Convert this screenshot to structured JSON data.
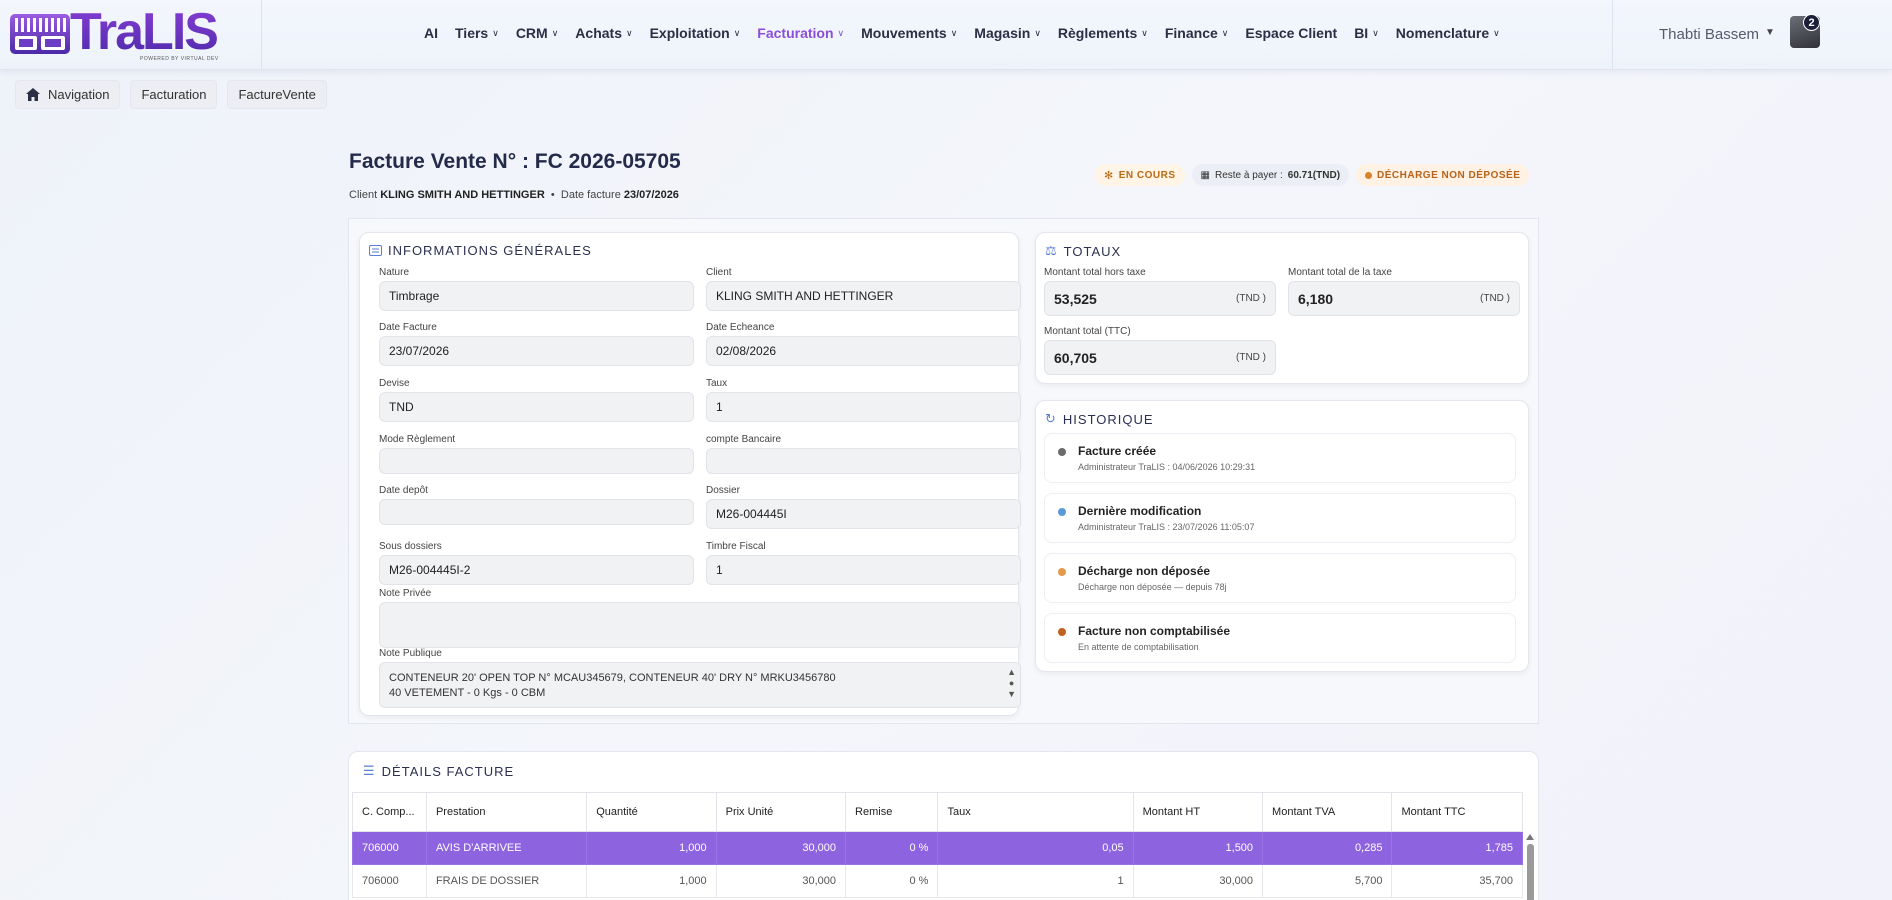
{
  "brand": {
    "logo_text": "TraLIS",
    "logo_tagline": "POWERED BY VIRTUAL DEV"
  },
  "nav": [
    {
      "label": "AI",
      "has_menu": false,
      "active": false
    },
    {
      "label": "Tiers",
      "has_menu": true,
      "active": false
    },
    {
      "label": "CRM",
      "has_menu": true,
      "active": false
    },
    {
      "label": "Achats",
      "has_menu": true,
      "active": false
    },
    {
      "label": "Exploitation",
      "has_menu": true,
      "active": false
    },
    {
      "label": "Facturation",
      "has_menu": true,
      "active": true
    },
    {
      "label": "Mouvements",
      "has_menu": true,
      "active": false
    },
    {
      "label": "Magasin",
      "has_menu": true,
      "active": false
    },
    {
      "label": "Règlements",
      "has_menu": true,
      "active": false
    },
    {
      "label": "Finance",
      "has_menu": true,
      "active": false
    },
    {
      "label": "Espace Client",
      "has_menu": false,
      "active": false
    },
    {
      "label": "BI",
      "has_menu": true,
      "active": false
    },
    {
      "label": "Nomenclature",
      "has_menu": true,
      "active": false
    }
  ],
  "user": {
    "name": "Thabti Bassem",
    "notifications": "2"
  },
  "breadcrumb": {
    "home_icon": "home-icon",
    "items": [
      "Navigation",
      "Facturation",
      "FactureVente"
    ]
  },
  "page": {
    "title": "Facture Vente N° : FC 2026-05705",
    "client_label": "Client",
    "client_value": "KLING SMITH AND HETTINGER",
    "separator": "•",
    "date_label": "Date facture",
    "date_value": "23/07/2026"
  },
  "badges": {
    "status": "EN COURS",
    "reste_label": "Reste à payer :",
    "reste_value": "60.71(TND)",
    "decharge": "DÉCHARGE NON DÉPOSÉE"
  },
  "info": {
    "title": "INFORMATIONS GÉNÉRALES",
    "nature_label": "Nature",
    "nature": "Timbrage",
    "client_label": "Client",
    "client": "KLING SMITH AND HETTINGER",
    "date_facture_label": "Date Facture",
    "date_facture": "23/07/2026",
    "date_echeance_label": "Date Echeance",
    "date_echeance": "02/08/2026",
    "devise_label": "Devise",
    "devise": "TND",
    "taux_label": "Taux",
    "taux": "1",
    "mode_label": "Mode Règlement",
    "mode": "",
    "compte_label": "compte Bancaire",
    "compte": "",
    "date_depot_label": "Date depôt",
    "date_depot": "",
    "dossier_label": "Dossier",
    "dossier": "M26-004445I",
    "sous_dossiers_label": "Sous dossiers",
    "sous_dossiers": "M26-004445I-2",
    "timbre_label": "Timbre Fiscal",
    "timbre": "1",
    "note_privee_label": "Note Privée",
    "note_privee": "",
    "note_publique_label": "Note Publique",
    "note_publique_line1": "CONTENEUR 20' OPEN TOP N° MCAU345679, CONTENEUR 40' DRY N° MRKU3456780",
    "note_publique_line2": "40 VETEMENT - 0 Kgs  - 0 CBM"
  },
  "totaux": {
    "title": "TOTAUX",
    "ht_label": "Montant total hors taxe",
    "ht": "53,525",
    "taxe_label": "Montant total de la taxe",
    "taxe": "6,180",
    "ttc_label": "Montant total (TTC)",
    "ttc": "60,705",
    "unit": "(TND )"
  },
  "historique": {
    "title": "HISTORIQUE",
    "items": [
      {
        "title": "Facture créée",
        "sub": "Administrateur TraLIS : 04/06/2026 10:29:31",
        "color": "#6b6b6b"
      },
      {
        "title": "Dernière modification",
        "sub": "Administrateur TraLIS : 23/07/2026 11:05:07",
        "color": "#5b9ad8"
      },
      {
        "title": "Décharge non déposée",
        "sub": "Décharge non déposée — depuis 78j",
        "color": "#e39a4a"
      },
      {
        "title": "Facture non comptabilisée",
        "sub": "En attente de comptabilisation",
        "color": "#c0621e"
      }
    ]
  },
  "details": {
    "title": "DÉTAILS FACTURE",
    "columns": [
      "C. Comp...",
      "Prestation",
      "Quantité",
      "Prix Unité",
      "Remise",
      "Taux",
      "Montant HT",
      "Montant TVA",
      "Montant TTC"
    ],
    "rows": [
      [
        "706000",
        "AVIS D'ARRIVEE",
        "1,000",
        "30,000",
        "0 %",
        "0,05",
        "1,500",
        "0,285",
        "1,785"
      ],
      [
        "706000",
        "FRAIS DE DOSSIER",
        "1,000",
        "30,000",
        "0 %",
        "1",
        "30,000",
        "5,700",
        "35,700"
      ]
    ]
  },
  "colors": {
    "accent": "#8a4fd8",
    "selected_row": "#8e63e0",
    "brand": "#3b1e8e"
  }
}
